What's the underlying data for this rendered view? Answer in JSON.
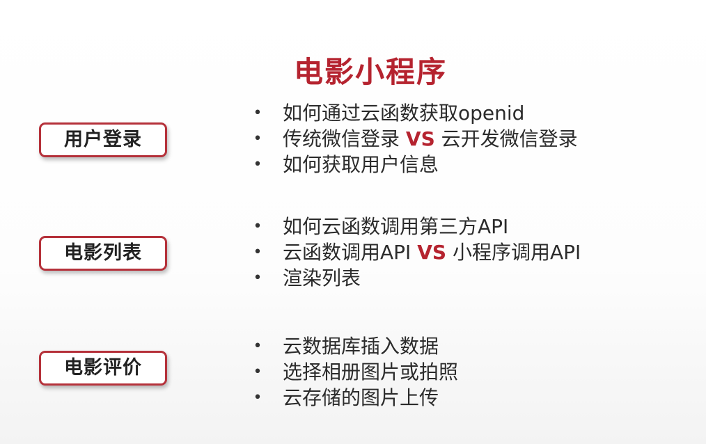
{
  "title": "电影小程序",
  "colors": {
    "accent": "#b5232f",
    "label_border": "#b5313a",
    "text": "#2b2b2b"
  },
  "bullet_symbol": "•",
  "sections": [
    {
      "label": "用户登录",
      "items": [
        {
          "text": "如何通过云函数获取openid"
        },
        {
          "before": "传统微信登录 ",
          "vs": "VS",
          "after": " 云开发微信登录"
        },
        {
          "text": "如何获取用户信息"
        }
      ]
    },
    {
      "label": "电影列表",
      "items": [
        {
          "text": "如何云函数调用第三方API"
        },
        {
          "before": "云函数调用API ",
          "vs": "VS",
          "after": " 小程序调用API"
        },
        {
          "text": "渲染列表"
        }
      ]
    },
    {
      "label": "电影评价",
      "items": [
        {
          "text": "云数据库插入数据"
        },
        {
          "text": "选择相册图片或拍照"
        },
        {
          "text": "云存储的图片上传"
        }
      ]
    }
  ]
}
